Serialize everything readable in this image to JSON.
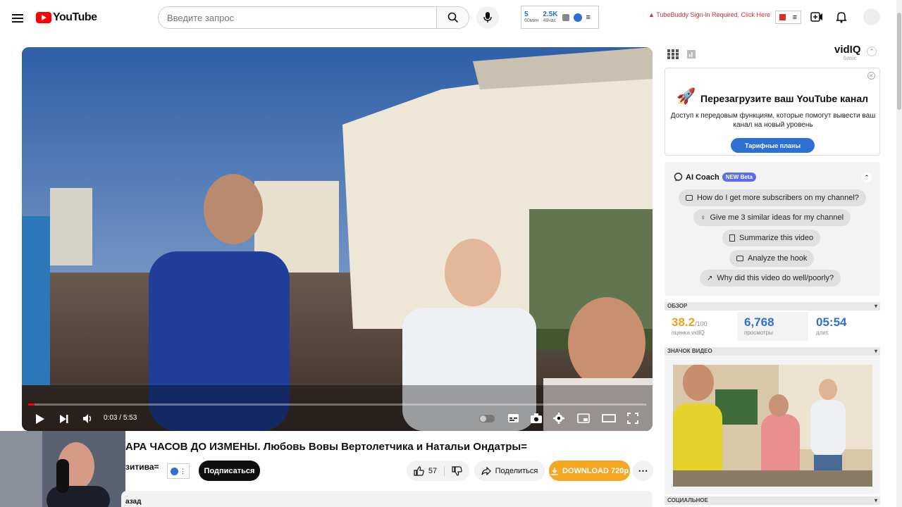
{
  "header": {
    "logo_text": "YouTube",
    "search_placeholder": "Введите запрос",
    "stats": [
      {
        "num": "5",
        "lbl": "60мин"
      },
      {
        "num": "2.5K",
        "lbl": "48час"
      }
    ],
    "tubebuddy_warning": "TubeBuddy Sign-in Required, Click Here",
    "icons": [
      "menu-icon",
      "search-icon",
      "mic-icon",
      "create-icon",
      "bell-icon",
      "avatar"
    ]
  },
  "player": {
    "time_current": "0:03",
    "time_total": "5:53",
    "time_separator": "/",
    "progress_fraction": 0.01
  },
  "video": {
    "title": "АРА ЧАСОВ ДО ИЗМЕНЫ. Любовь Вовы Вертолетчика и Натальи Ондатры=",
    "channel_fragment": "зитива=",
    "subscribe_label": "Подписаться",
    "likes": "57",
    "share_label": "Поделиться",
    "download_label": "DOWNLOAD 720p",
    "below_fragment": "азад"
  },
  "vidiq": {
    "logo": "vidIQ",
    "tier": "basic",
    "promo_title": "Перезагрузите ваш YouTube канал",
    "promo_text": "Доступ к передовым функциям, которые помогут вывести ваш канал на новый уровень",
    "promo_button": "Тарифные планы",
    "coach_title": "AI Coach",
    "coach_badge": "NEW Beta",
    "coach_chips": [
      "How do I get more subscribers on my channel?",
      "Give me 3 similar ideas for my channel",
      "Summarize this video",
      "Analyze the hook",
      "Why did this video do well/poorly?"
    ],
    "overview_label": "ОБЗОР",
    "score_value": "38.2",
    "score_max": "/100",
    "score_label": "оценка vidIQ",
    "views_value": "6,768",
    "views_label": "просмотры",
    "duration_value": "05:54",
    "duration_label": "длит.",
    "thumb_label": "ЗНАЧОК ВИДЕО",
    "social_label": "СОЦИАЛЬНОЕ"
  },
  "colors": {
    "accent_red": "#ff0000",
    "vidiq_blue": "#2e6fd4",
    "download_orange": "#f5a623",
    "score_orange": "#f0a020"
  }
}
